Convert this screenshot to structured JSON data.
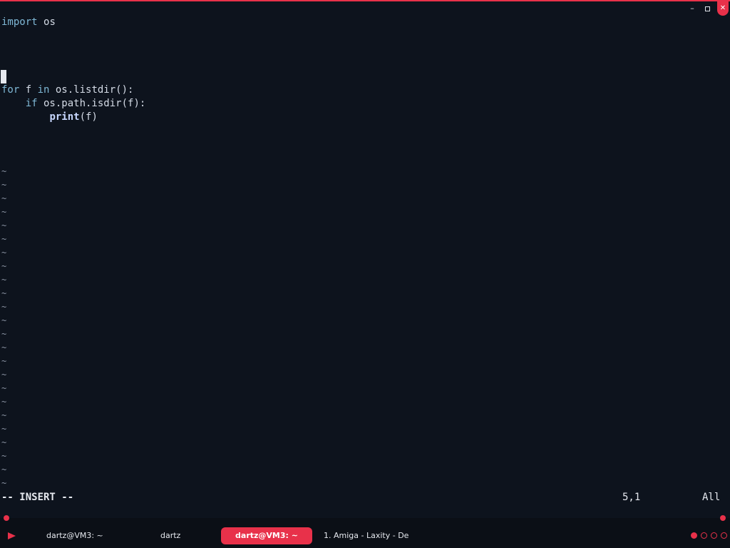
{
  "window": {
    "controls": {
      "minimize": "–",
      "close": "✕"
    }
  },
  "editor": {
    "lines": [
      {
        "text": "import os"
      },
      {
        "text": ""
      },
      {
        "text": ""
      },
      {
        "text": ""
      },
      {
        "text": ""
      },
      {
        "text": "for f in os.listdir():"
      },
      {
        "text": "    if os.path.isdir(f):"
      },
      {
        "text": "        print(f)"
      }
    ],
    "tilde": "~",
    "status": {
      "mode": "-- INSERT --",
      "position": "5,1",
      "scroll": "All"
    }
  },
  "taskbar": {
    "launcher_icon": "play-icon",
    "tasks": [
      {
        "label": "dartz@VM3: ~"
      },
      {
        "label": "dartz"
      },
      {
        "label": "dartz@VM3: ~",
        "active": true
      },
      {
        "label": "1. Amiga - Laxity - De"
      }
    ],
    "workspaces": [
      true,
      false,
      false,
      false
    ]
  },
  "colors": {
    "background": "#0d131d",
    "accent": "#e8314a",
    "keyword": "#7fb8d6",
    "text": "#d4dbe6"
  }
}
